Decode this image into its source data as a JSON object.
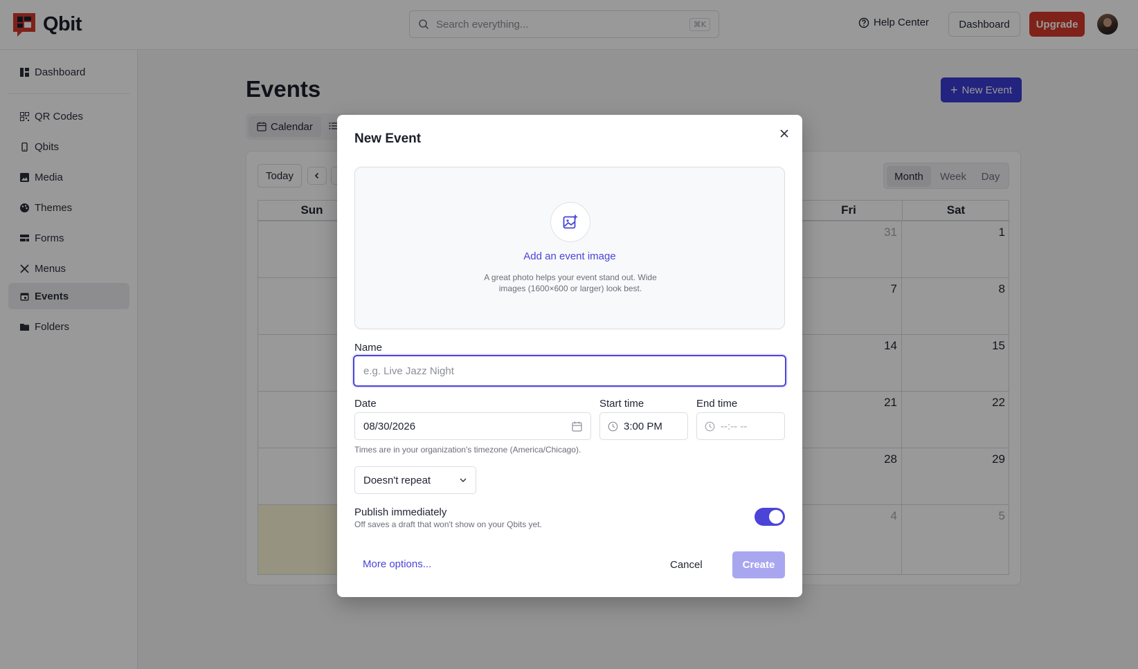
{
  "brand": {
    "name": "Qbit",
    "accent": "#d43a2c",
    "primary": "#3b3bd6"
  },
  "header": {
    "search_placeholder": "Search everything...",
    "search_shortcut": "⌘K",
    "help_label": "Help Center",
    "dashboard_label": "Dashboard",
    "upgrade_label": "Upgrade"
  },
  "sidebar": {
    "items": [
      {
        "label": "Dashboard",
        "icon": "dashboard-icon"
      },
      {
        "label": "QR Codes",
        "icon": "qr-code-icon"
      },
      {
        "label": "Qbits",
        "icon": "phone-icon"
      },
      {
        "label": "Media",
        "icon": "image-icon"
      },
      {
        "label": "Themes",
        "icon": "palette-icon"
      },
      {
        "label": "Forms",
        "icon": "form-icon"
      },
      {
        "label": "Menus",
        "icon": "utensils-icon"
      },
      {
        "label": "Events",
        "icon": "calendar-icon",
        "active": true
      },
      {
        "label": "Folders",
        "icon": "folder-icon"
      }
    ]
  },
  "main": {
    "title": "Events",
    "new_event_label": "New Event",
    "tabs": [
      {
        "label": "Calendar",
        "icon": "calendar-icon"
      },
      {
        "label": "",
        "icon": "list-icon"
      }
    ]
  },
  "calendar": {
    "today_label": "Today",
    "ranges": [
      "Month",
      "Week",
      "Day"
    ],
    "active_range": "Month",
    "days_of_week": [
      "Sun",
      "",
      "",
      "",
      "",
      "Fri",
      "Sat"
    ],
    "visible_day_numbers": {
      "fri": [
        "31",
        "7",
        "14",
        "21",
        "28",
        "4"
      ],
      "sat": [
        "1",
        "8",
        "15",
        "22",
        "29",
        "5"
      ]
    }
  },
  "modal": {
    "title": "New Event",
    "image": {
      "add_label": "Add an event image",
      "help": "A great photo helps your event stand out. Wide images (1600×600 or larger) look best."
    },
    "name_label": "Name",
    "name_placeholder": "e.g. Live Jazz Night",
    "name_value": "",
    "date_label": "Date",
    "date_value": "08/30/2026",
    "start_label": "Start time",
    "start_value": "3:00 PM",
    "end_label": "End time",
    "end_placeholder": "--:-- --",
    "timezone_note": "Times are in your organization's timezone (America/Chicago).",
    "repeat_value": "Doesn't repeat",
    "publish_title": "Publish immediately",
    "publish_sub": "Off saves a draft that won't show on your Qbits yet.",
    "publish_on": true,
    "more_options": "More options...",
    "cancel_label": "Cancel",
    "create_label": "Create"
  }
}
